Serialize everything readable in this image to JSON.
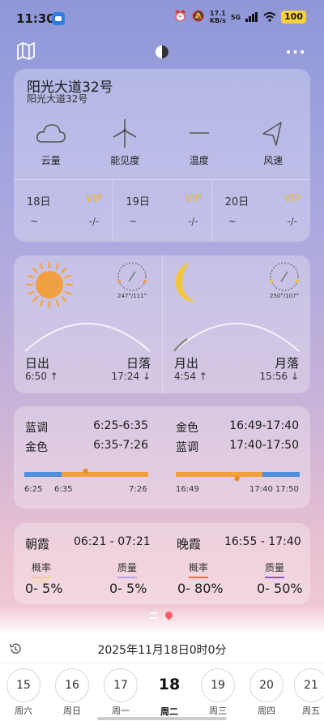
{
  "status": {
    "time": "11:30",
    "net_speed_top": "17.1",
    "net_speed_bottom": "KB/s",
    "network": "5G",
    "battery": "100"
  },
  "location": {
    "name": "阳光大道32号",
    "subtitle": "阳光大道32号"
  },
  "metrics": [
    {
      "icon": "cloud-icon",
      "label": "云量"
    },
    {
      "icon": "wind-turbine-icon",
      "label": "能见度"
    },
    {
      "icon": "dash-icon",
      "label": "温度"
    },
    {
      "icon": "wind-direction-icon",
      "label": "风速"
    }
  ],
  "days": [
    {
      "date": "18日",
      "vip": "VIP",
      "a": "~",
      "b": "-/-"
    },
    {
      "date": "19日",
      "vip": "VIP",
      "a": "~",
      "b": "-/-"
    },
    {
      "date": "20日",
      "vip": "VIP",
      "a": "~",
      "b": "-/-"
    }
  ],
  "sun": {
    "dial": "247°/111°",
    "rise_label": "日出",
    "rise_time": "6:50 ↑",
    "set_label": "日落",
    "set_time": "17:24 ↓"
  },
  "moon": {
    "dial": "250°/107°",
    "rise_label": "月出",
    "rise_time": "4:54 ↑",
    "set_label": "月落",
    "set_time": "15:56 ↓"
  },
  "golden": {
    "morning": [
      {
        "label": "蓝调",
        "range": "6:25-6:35"
      },
      {
        "label": "金色",
        "range": "6:35-7:26"
      }
    ],
    "evening": [
      {
        "label": "金色",
        "range": "16:49-17:40"
      },
      {
        "label": "蓝调",
        "range": "17:40-17:50"
      }
    ],
    "morning_ticks": [
      "6:25",
      "6:35",
      "7:26"
    ],
    "evening_ticks": [
      "16:49",
      "17:40",
      "17:50"
    ],
    "colors": {
      "blue_hour": "#4f8fe0",
      "golden_hour": "#f0a040"
    }
  },
  "glow": {
    "morning_title": "朝霞",
    "morning_range": "06:21 - 07:21",
    "evening_title": "晚霞",
    "evening_range": "16:55 - 17:40",
    "items": [
      {
        "key": "概率",
        "value": "0- 5%",
        "color": "#f2d95a"
      },
      {
        "key": "质量",
        "value": "0- 5%",
        "color": "#b9a3e8"
      },
      {
        "key": "概率",
        "value": "0- 80%",
        "color": "#f06a3a"
      },
      {
        "key": "质量",
        "value": "0- 50%",
        "color": "#8a4ee0"
      }
    ]
  },
  "bottom": {
    "datetime": "2025年11月18日0时0分",
    "dates": [
      {
        "day": "15",
        "weekday": "周六"
      },
      {
        "day": "16",
        "weekday": "周日"
      },
      {
        "day": "17",
        "weekday": "周一"
      },
      {
        "day": "18",
        "weekday": "周二"
      },
      {
        "day": "19",
        "weekday": "周三"
      },
      {
        "day": "20",
        "weekday": "周四"
      },
      {
        "day": "21",
        "weekday": "周五"
      }
    ],
    "selected_index": 3
  }
}
